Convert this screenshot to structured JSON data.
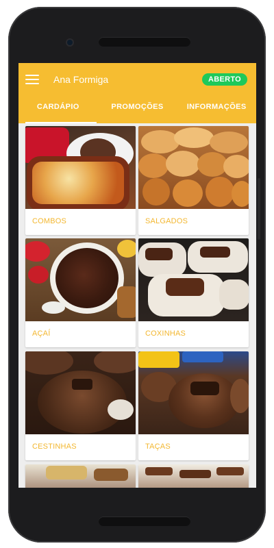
{
  "app": {
    "title": "Ana Formiga",
    "status": "ABERTO",
    "accent_color": "#f6bd31",
    "status_color": "#1ec95a",
    "label_color": "#f3b730"
  },
  "tabs": [
    {
      "label": "CARDÁPIO",
      "active": true
    },
    {
      "label": "PROMOÇÕES",
      "active": false
    },
    {
      "label": "INFORMAÇÕES",
      "active": false
    }
  ],
  "categories": [
    {
      "label": "COMBOS",
      "image": "lasagna-and-soda-photo"
    },
    {
      "label": "SALGADOS",
      "image": "savory-snacks-photo"
    },
    {
      "label": "AÇAÍ",
      "image": "acai-bowl-photo"
    },
    {
      "label": "COXINHAS",
      "image": "chocolate-coxinhas-photo"
    },
    {
      "label": "CESTINHAS",
      "image": "chocolate-baskets-photo"
    },
    {
      "label": "TAÇAS",
      "image": "dessert-cups-photo"
    },
    {
      "label": "",
      "image": "chocolate-treats-photo"
    },
    {
      "label": "",
      "image": "chocolate-bars-photo"
    }
  ]
}
